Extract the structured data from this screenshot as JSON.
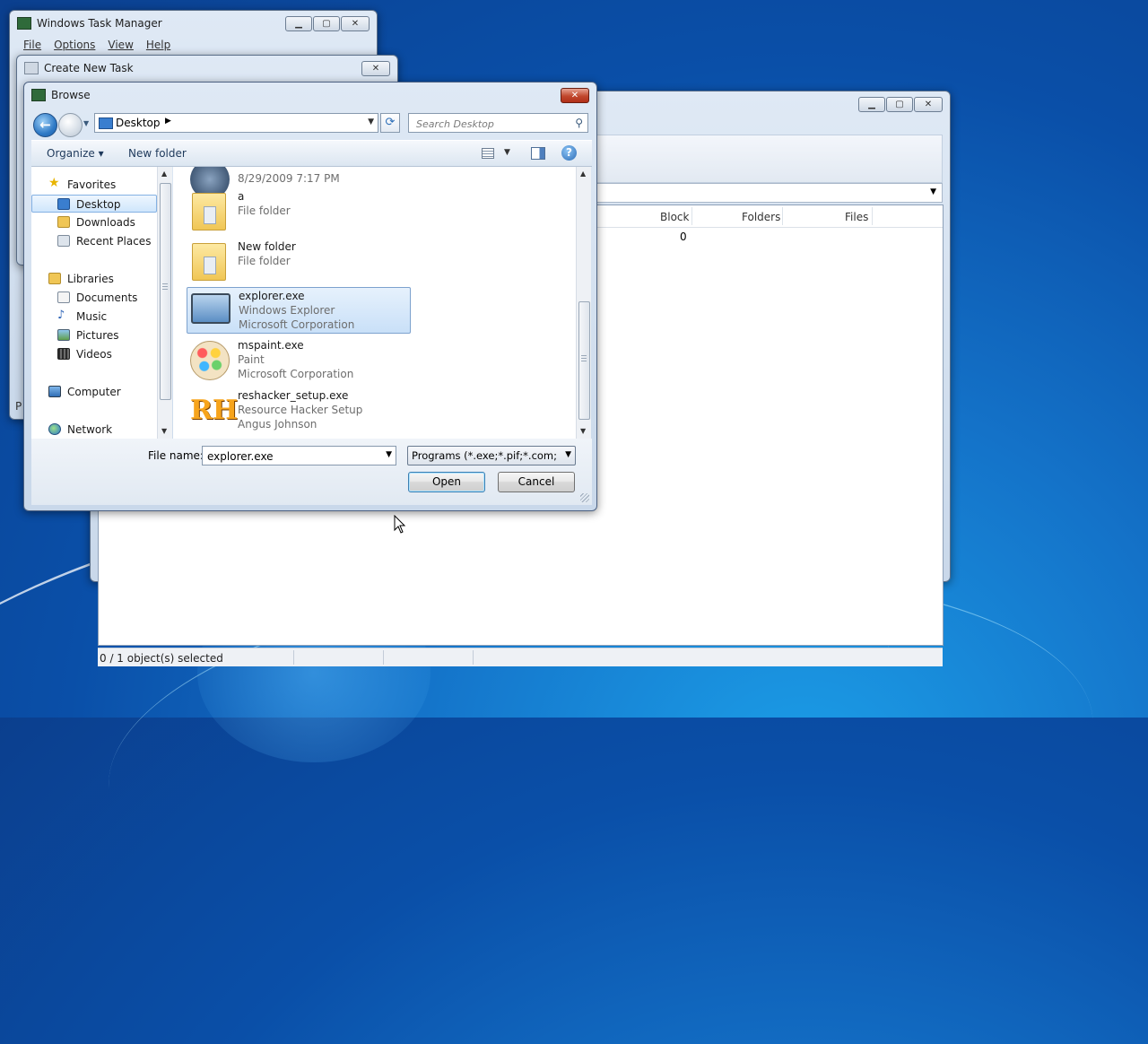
{
  "taskmgr": {
    "title": "Windows Task Manager",
    "menu": [
      "File",
      "Options",
      "View",
      "Help"
    ],
    "strip_letter": "P"
  },
  "create_task": {
    "title": "Create New Task"
  },
  "background_window": {
    "columns": [
      "Block",
      "Folders",
      "Files"
    ],
    "row_value": "0",
    "status": "0 / 1 object(s) selected"
  },
  "browse": {
    "title": "Browse",
    "address": "Desktop",
    "search_placeholder": "Search Desktop",
    "toolbar": {
      "organize": "Organize ▾",
      "new_folder": "New folder",
      "help": "?"
    },
    "nav": [
      {
        "label": "Favorites",
        "icon": "star-icon"
      },
      {
        "label": "Desktop",
        "icon": "desktop-icon",
        "selected": true
      },
      {
        "label": "Downloads",
        "icon": "downloads-icon"
      },
      {
        "label": "Recent Places",
        "icon": "recent-places-icon"
      },
      {
        "label": "Libraries",
        "icon": "libraries-icon"
      },
      {
        "label": "Documents",
        "icon": "documents-icon"
      },
      {
        "label": "Music",
        "icon": "music-icon"
      },
      {
        "label": "Pictures",
        "icon": "pictures-icon"
      },
      {
        "label": "Videos",
        "icon": "videos-icon"
      },
      {
        "label": "Computer",
        "icon": "computer-icon"
      },
      {
        "label": "Network",
        "icon": "network-icon"
      }
    ],
    "files": [
      {
        "name": "",
        "line2": "8/29/2009 7:17 PM",
        "line3": "",
        "icon": "disc-icon"
      },
      {
        "name": "a",
        "line2": "File folder",
        "line3": "",
        "icon": "folder-icon"
      },
      {
        "name": "New folder",
        "line2": "File folder",
        "line3": "",
        "icon": "folder-icon"
      },
      {
        "name": "explorer.exe",
        "line2": "Windows Explorer",
        "line3": "Microsoft Corporation",
        "icon": "explorer-icon",
        "selected": true
      },
      {
        "name": "mspaint.exe",
        "line2": "Paint",
        "line3": "Microsoft Corporation",
        "icon": "paint-icon"
      },
      {
        "name": "reshacker_setup.exe",
        "line2": "Resource Hacker Setup",
        "line3": "Angus Johnson",
        "icon": "reshacker-icon"
      }
    ],
    "file_name_label": "File name:",
    "file_name_value": "explorer.exe",
    "file_type": "Programs (*.exe;*.pif;*.com;*.bat;*.cmd)",
    "open_label": "Open",
    "cancel_label": "Cancel"
  }
}
